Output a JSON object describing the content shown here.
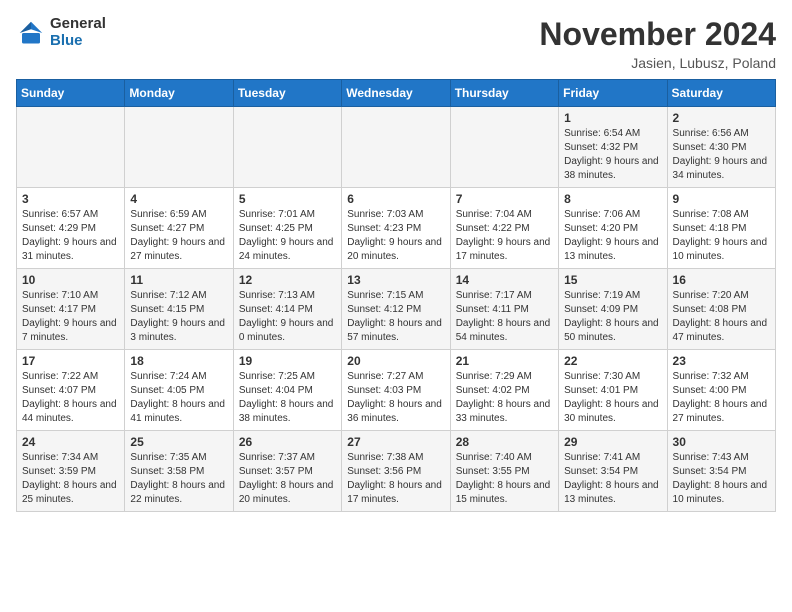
{
  "header": {
    "logo_general": "General",
    "logo_blue": "Blue",
    "month_title": "November 2024",
    "location": "Jasien, Lubusz, Poland"
  },
  "days_of_week": [
    "Sunday",
    "Monday",
    "Tuesday",
    "Wednesday",
    "Thursday",
    "Friday",
    "Saturday"
  ],
  "weeks": [
    [
      {
        "day": "",
        "info": ""
      },
      {
        "day": "",
        "info": ""
      },
      {
        "day": "",
        "info": ""
      },
      {
        "day": "",
        "info": ""
      },
      {
        "day": "",
        "info": ""
      },
      {
        "day": "1",
        "info": "Sunrise: 6:54 AM\nSunset: 4:32 PM\nDaylight: 9 hours and 38 minutes."
      },
      {
        "day": "2",
        "info": "Sunrise: 6:56 AM\nSunset: 4:30 PM\nDaylight: 9 hours and 34 minutes."
      }
    ],
    [
      {
        "day": "3",
        "info": "Sunrise: 6:57 AM\nSunset: 4:29 PM\nDaylight: 9 hours and 31 minutes."
      },
      {
        "day": "4",
        "info": "Sunrise: 6:59 AM\nSunset: 4:27 PM\nDaylight: 9 hours and 27 minutes."
      },
      {
        "day": "5",
        "info": "Sunrise: 7:01 AM\nSunset: 4:25 PM\nDaylight: 9 hours and 24 minutes."
      },
      {
        "day": "6",
        "info": "Sunrise: 7:03 AM\nSunset: 4:23 PM\nDaylight: 9 hours and 20 minutes."
      },
      {
        "day": "7",
        "info": "Sunrise: 7:04 AM\nSunset: 4:22 PM\nDaylight: 9 hours and 17 minutes."
      },
      {
        "day": "8",
        "info": "Sunrise: 7:06 AM\nSunset: 4:20 PM\nDaylight: 9 hours and 13 minutes."
      },
      {
        "day": "9",
        "info": "Sunrise: 7:08 AM\nSunset: 4:18 PM\nDaylight: 9 hours and 10 minutes."
      }
    ],
    [
      {
        "day": "10",
        "info": "Sunrise: 7:10 AM\nSunset: 4:17 PM\nDaylight: 9 hours and 7 minutes."
      },
      {
        "day": "11",
        "info": "Sunrise: 7:12 AM\nSunset: 4:15 PM\nDaylight: 9 hours and 3 minutes."
      },
      {
        "day": "12",
        "info": "Sunrise: 7:13 AM\nSunset: 4:14 PM\nDaylight: 9 hours and 0 minutes."
      },
      {
        "day": "13",
        "info": "Sunrise: 7:15 AM\nSunset: 4:12 PM\nDaylight: 8 hours and 57 minutes."
      },
      {
        "day": "14",
        "info": "Sunrise: 7:17 AM\nSunset: 4:11 PM\nDaylight: 8 hours and 54 minutes."
      },
      {
        "day": "15",
        "info": "Sunrise: 7:19 AM\nSunset: 4:09 PM\nDaylight: 8 hours and 50 minutes."
      },
      {
        "day": "16",
        "info": "Sunrise: 7:20 AM\nSunset: 4:08 PM\nDaylight: 8 hours and 47 minutes."
      }
    ],
    [
      {
        "day": "17",
        "info": "Sunrise: 7:22 AM\nSunset: 4:07 PM\nDaylight: 8 hours and 44 minutes."
      },
      {
        "day": "18",
        "info": "Sunrise: 7:24 AM\nSunset: 4:05 PM\nDaylight: 8 hours and 41 minutes."
      },
      {
        "day": "19",
        "info": "Sunrise: 7:25 AM\nSunset: 4:04 PM\nDaylight: 8 hours and 38 minutes."
      },
      {
        "day": "20",
        "info": "Sunrise: 7:27 AM\nSunset: 4:03 PM\nDaylight: 8 hours and 36 minutes."
      },
      {
        "day": "21",
        "info": "Sunrise: 7:29 AM\nSunset: 4:02 PM\nDaylight: 8 hours and 33 minutes."
      },
      {
        "day": "22",
        "info": "Sunrise: 7:30 AM\nSunset: 4:01 PM\nDaylight: 8 hours and 30 minutes."
      },
      {
        "day": "23",
        "info": "Sunrise: 7:32 AM\nSunset: 4:00 PM\nDaylight: 8 hours and 27 minutes."
      }
    ],
    [
      {
        "day": "24",
        "info": "Sunrise: 7:34 AM\nSunset: 3:59 PM\nDaylight: 8 hours and 25 minutes."
      },
      {
        "day": "25",
        "info": "Sunrise: 7:35 AM\nSunset: 3:58 PM\nDaylight: 8 hours and 22 minutes."
      },
      {
        "day": "26",
        "info": "Sunrise: 7:37 AM\nSunset: 3:57 PM\nDaylight: 8 hours and 20 minutes."
      },
      {
        "day": "27",
        "info": "Sunrise: 7:38 AM\nSunset: 3:56 PM\nDaylight: 8 hours and 17 minutes."
      },
      {
        "day": "28",
        "info": "Sunrise: 7:40 AM\nSunset: 3:55 PM\nDaylight: 8 hours and 15 minutes."
      },
      {
        "day": "29",
        "info": "Sunrise: 7:41 AM\nSunset: 3:54 PM\nDaylight: 8 hours and 13 minutes."
      },
      {
        "day": "30",
        "info": "Sunrise: 7:43 AM\nSunset: 3:54 PM\nDaylight: 8 hours and 10 minutes."
      }
    ]
  ]
}
